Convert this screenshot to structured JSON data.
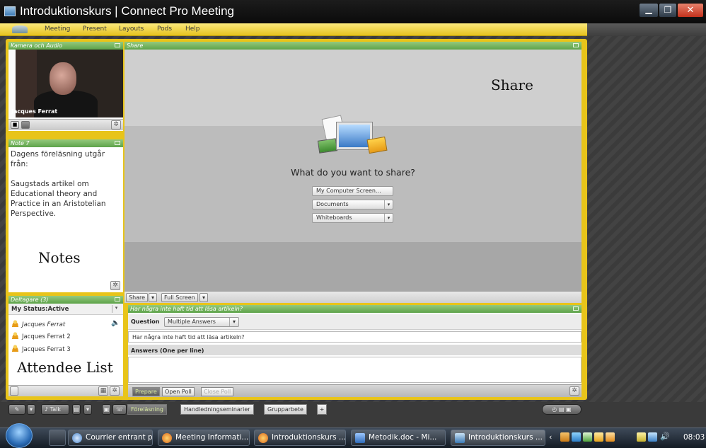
{
  "window": {
    "title": "Introduktionskurs | Connect Pro Meeting",
    "minimize": "▁",
    "maximize": "❐",
    "close": "✕"
  },
  "menu": [
    "Meeting",
    "Present",
    "Layouts",
    "Pods",
    "Help"
  ],
  "camera": {
    "title": "Kamera och Audio",
    "presenter": "Jacques Ferrat"
  },
  "notes": {
    "title": "Note 7",
    "text": "Dagens föreläsning utgår från:\n\nSaugstads artikel om Educational theory and Practice in an Aristotelian Perspective.",
    "overlay": "Notes"
  },
  "attendees": {
    "title": "Deltagare (3)",
    "status": "My Status:Active",
    "list": [
      "Jacques Ferrat",
      "Jacques Ferrat 2",
      "Jacques Ferrat 3"
    ],
    "overlay": "Attendee List"
  },
  "share": {
    "title": "Share",
    "overlay": "Share",
    "prompt": "What do you want to share?",
    "options": [
      "My Computer Screen...",
      "Documents",
      "Whiteboards"
    ],
    "toolbar": {
      "share": "Share",
      "fullscreen": "Full Screen"
    }
  },
  "poll": {
    "title": "Har några inte haft tid att läsa artikeln?",
    "question_label": "Question",
    "answer_type": "Multiple Answers",
    "question_text": "Har några inte haft tid att läsa artikeln?",
    "answers_label": "Answers (One per line)",
    "tabs": [
      "Prepare",
      "Open Poll",
      "Close Poll"
    ]
  },
  "layouts": {
    "talk": "Talk",
    "tabs": [
      "Föreläsning",
      "Handledningseminarier",
      "Grupparbete"
    ],
    "add": "+"
  },
  "taskbar": {
    "items": [
      "Courrier entrant p...",
      "Meeting Informati...",
      "Introduktionskurs ...",
      "Metodik.doc - Mi...",
      "Introduktionskurs ..."
    ],
    "time": "08:03"
  },
  "colors": {
    "accent": "#e8c41a",
    "pod_header": "#5ea34a"
  }
}
